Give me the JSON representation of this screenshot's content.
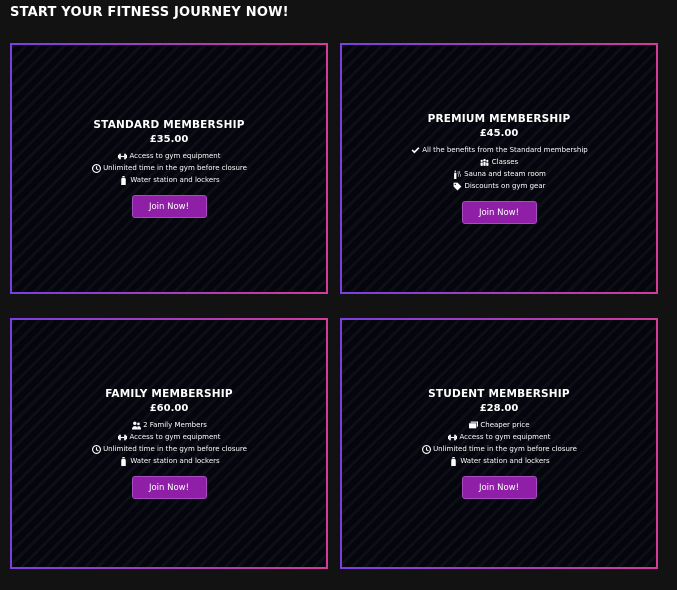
{
  "page": {
    "title": "START YOUR FITNESS JOURNEY NOW!"
  },
  "colors": {
    "background": "#121212",
    "card_background": "#05060d",
    "border_gradient_start": "#7b3fe0",
    "border_gradient_end": "#d23b9a",
    "button": "#8e1fa6"
  },
  "memberships": [
    {
      "title": "STANDARD MEMBERSHIP",
      "price": "£35.00",
      "features": [
        {
          "icon": "dumbbell-icon",
          "text": "Access to gym equipment"
        },
        {
          "icon": "clock-icon",
          "text": "Unlimited time in the gym before closure"
        },
        {
          "icon": "bottle-icon",
          "text": "Water station and lockers"
        }
      ],
      "button_label": "Join Now!"
    },
    {
      "title": "PREMIUM MEMBERSHIP",
      "price": "£45.00",
      "features": [
        {
          "icon": "check-icon",
          "text": "All the benefits from the Standard membership"
        },
        {
          "icon": "people-group-icon",
          "text": "Classes"
        },
        {
          "icon": "spa-icon",
          "text": "Sauna and steam room"
        },
        {
          "icon": "tag-icon",
          "text": "Discounts on gym gear"
        }
      ],
      "button_label": "Join Now!"
    },
    {
      "title": "FAMILY MEMBERSHIP",
      "price": "£60.00",
      "features": [
        {
          "icon": "user-group-icon",
          "text": "2 Family Members"
        },
        {
          "icon": "dumbbell-icon",
          "text": "Access to gym equipment"
        },
        {
          "icon": "clock-icon",
          "text": "Unlimited time in the gym before closure"
        },
        {
          "icon": "bottle-icon",
          "text": "Water station and lockers"
        }
      ],
      "button_label": "Join Now!"
    },
    {
      "title": "STUDENT MEMBERSHIP",
      "price": "£28.00",
      "features": [
        {
          "icon": "money-icon",
          "text": "Cheaper price"
        },
        {
          "icon": "dumbbell-icon",
          "text": "Access to gym equipment"
        },
        {
          "icon": "clock-icon",
          "text": "Unlimited time in the gym before closure"
        },
        {
          "icon": "bottle-icon",
          "text": "Water station and lockers"
        }
      ],
      "button_label": "Join Now!"
    }
  ]
}
